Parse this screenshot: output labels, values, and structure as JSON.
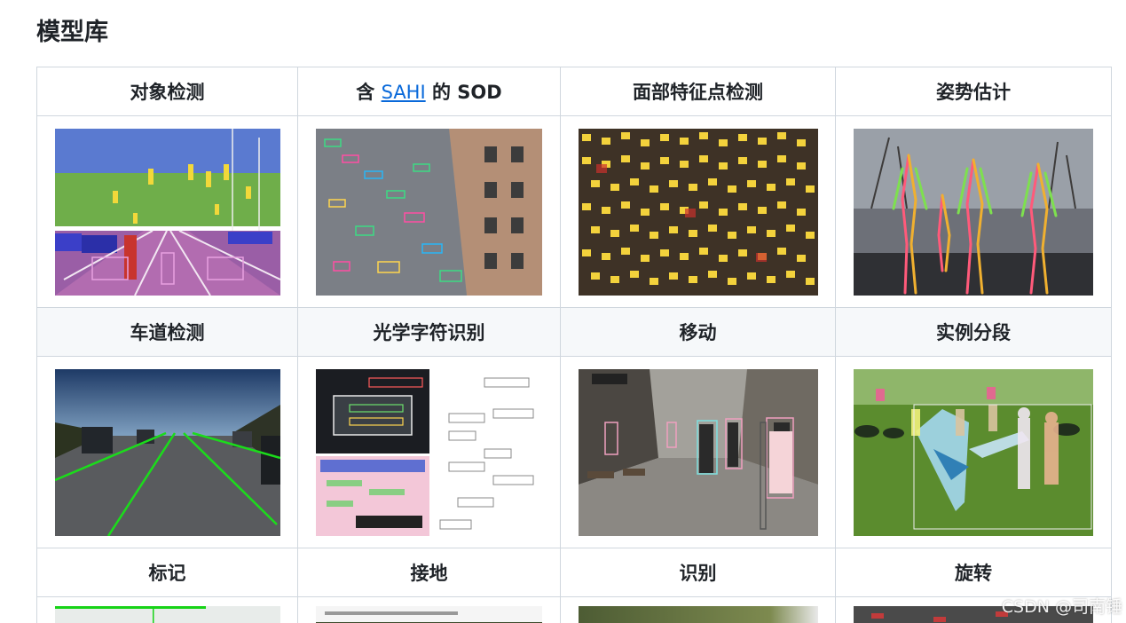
{
  "page": {
    "title": "模型库"
  },
  "table": {
    "row1": {
      "headers": [
        "对象检测",
        "含",
        "面部特征点检测",
        "姿势估计"
      ],
      "sod_link": "SAHI",
      "sod_suffix": "的 SOD"
    },
    "row2": {
      "headers": [
        "车道检测",
        "光学字符识别",
        "移动",
        "实例分段"
      ]
    },
    "row3": {
      "headers": [
        "标记",
        "接地",
        "识别",
        "旋转"
      ]
    }
  },
  "images": {
    "img1": "object-detection-demo",
    "img2": "sahi-sod-demo",
    "img3": "face-landmark-demo",
    "img4": "pose-estimation-demo",
    "img5": "lane-detection-demo",
    "img6": "ocr-demo",
    "img7": "mot-demo",
    "img8": "instance-segmentation-demo"
  },
  "watermark": "CSDN @司南锤",
  "colors": {
    "link": "#0969da",
    "border": "#d0d7de",
    "alt_row": "#f6f8fa"
  }
}
